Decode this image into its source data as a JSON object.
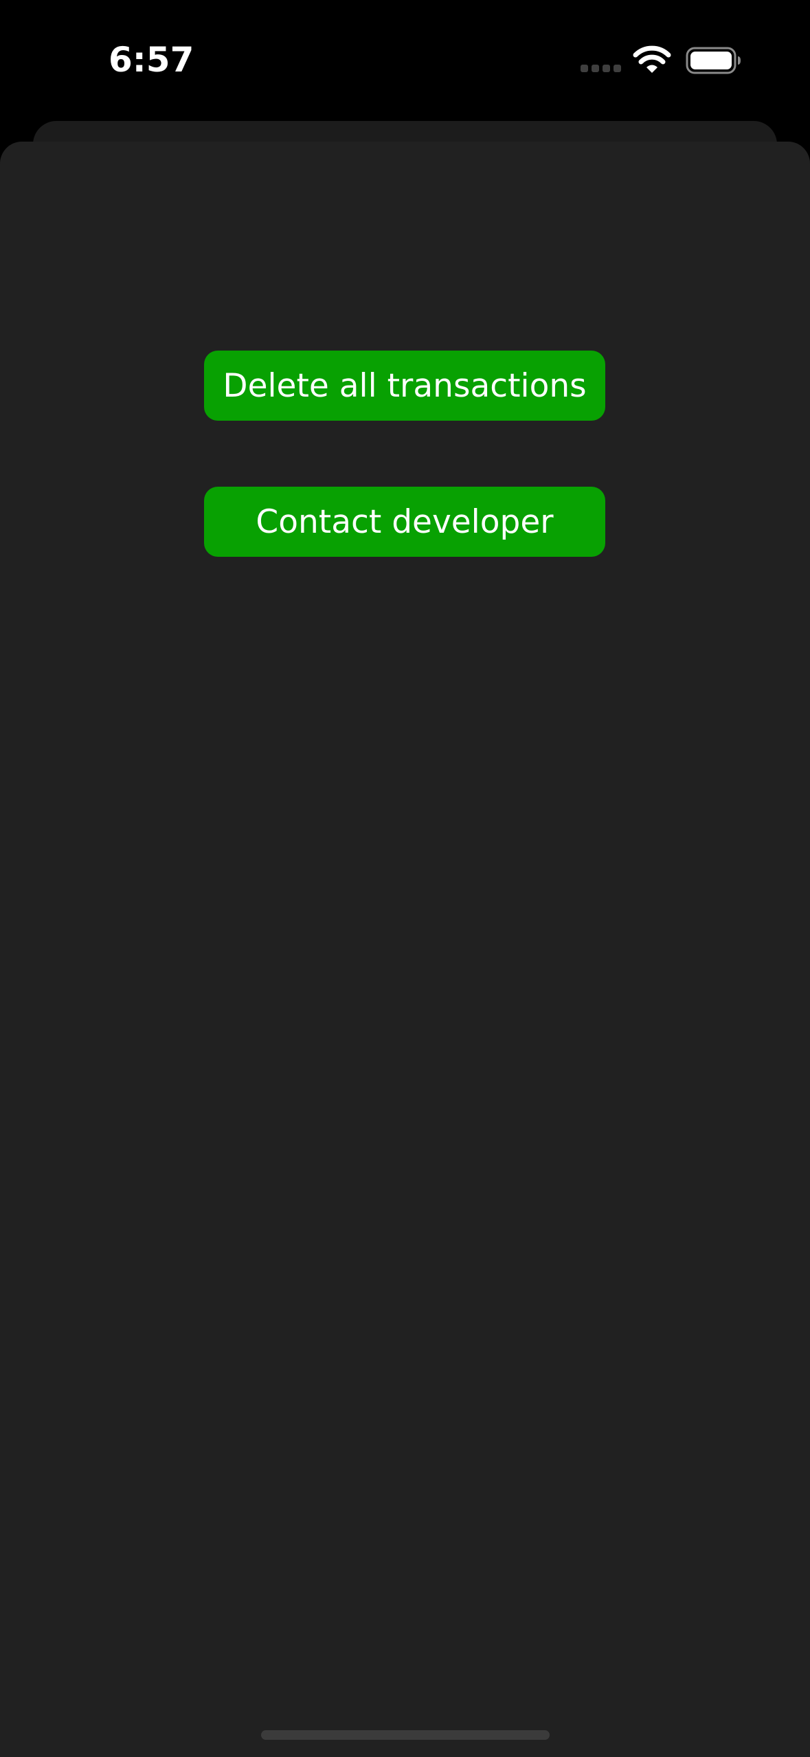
{
  "status_bar": {
    "time": "6:57",
    "icons": [
      "signal-dots-icon",
      "wifi-icon",
      "battery-icon"
    ]
  },
  "settings": {
    "delete_all_label": "Delete all transactions",
    "contact_developer_label": "Contact developer"
  },
  "colors": {
    "background": "#000000",
    "sheet": "#212121",
    "button": "#08a102",
    "button_text": "#ffffff"
  }
}
